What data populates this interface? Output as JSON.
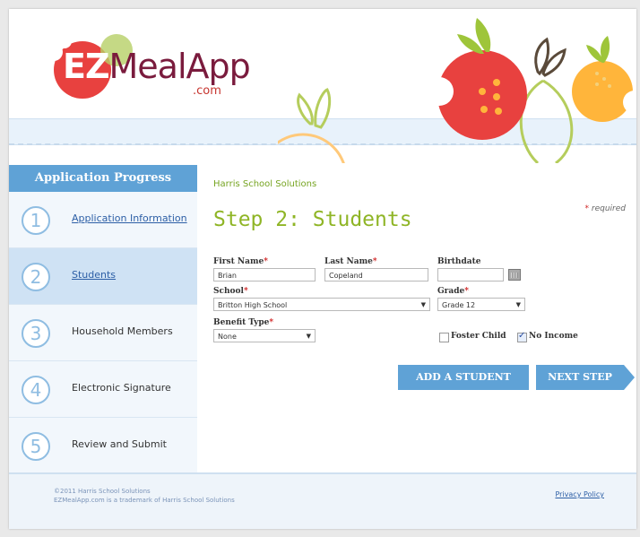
{
  "header": {
    "logo": {
      "ez": "EZ",
      "rest": "MealApp",
      "com": ".com"
    }
  },
  "sidebar": {
    "title": "Application Progress",
    "steps": [
      {
        "num": "1",
        "label": "Application Information",
        "active": false,
        "link": true
      },
      {
        "num": "2",
        "label": "Students",
        "active": true,
        "link": true
      },
      {
        "num": "3",
        "label": "Household Members",
        "active": false,
        "link": false
      },
      {
        "num": "4",
        "label": "Electronic Signature",
        "active": false,
        "link": false
      },
      {
        "num": "5",
        "label": "Review and Submit",
        "active": false,
        "link": false
      }
    ]
  },
  "main": {
    "org": "Harris School Solutions",
    "required_star": "*",
    "required_text": "required",
    "heading": "Step 2: Students",
    "fields": {
      "first_name": {
        "label": "First Name",
        "value": "Brian"
      },
      "last_name": {
        "label": "Last Name",
        "value": "Copeland"
      },
      "birthdate": {
        "label": "Birthdate",
        "value": ""
      },
      "school": {
        "label": "School",
        "value": "Britton High School"
      },
      "grade": {
        "label": "Grade",
        "value": "Grade 12"
      },
      "benefit_type": {
        "label": "Benefit Type",
        "value": "None"
      }
    },
    "foster_child": {
      "label": "Foster Child",
      "checked": false
    },
    "no_income": {
      "label": "No Income",
      "checked": true
    },
    "add_student": "ADD A STUDENT",
    "next_step": "NEXT STEP"
  },
  "footer": {
    "copyright": "©2011 Harris School Solutions",
    "trademark": "EZMealApp.com is a trademark of Harris School Solutions",
    "privacy": "Privacy Policy"
  },
  "colors": {
    "accent_blue": "#5fa2d6",
    "heading_green": "#8fb526",
    "brand_maroon": "#7a1b3d",
    "apple_red": "#e8413f"
  }
}
